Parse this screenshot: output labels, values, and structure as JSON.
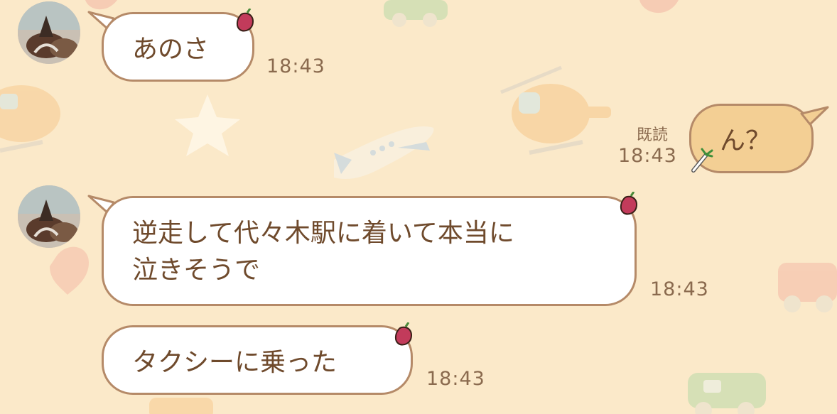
{
  "messages": [
    {
      "sender": "other",
      "text": "あのさ",
      "time": "18:43"
    },
    {
      "sender": "me",
      "text": "ん？",
      "time": "18:43",
      "read_label": "既読"
    },
    {
      "sender": "other",
      "text": "逆走して代々木駅に着いて本当に\n泣きそうで",
      "time": "18:43"
    },
    {
      "sender": "other",
      "text": "タクシーに乗った",
      "time": "18:43"
    }
  ],
  "colors": {
    "background": "#fbe9c9",
    "bubble_other": "#ffffff",
    "bubble_me": "#f3cf94",
    "bubble_border": "#b58a68",
    "text": "#6f4a2c",
    "meta_text": "#8a6a4e"
  },
  "icons": [
    "avatar",
    "sweet-potato-icon",
    "green-onion-icon"
  ]
}
